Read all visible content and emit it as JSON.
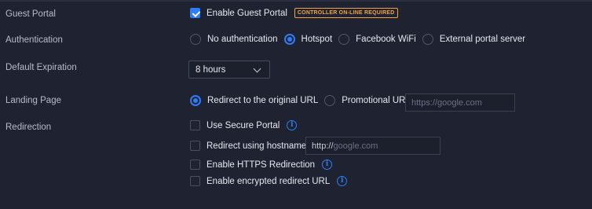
{
  "guest_portal": {
    "label": "Guest Portal",
    "enable_label": "Enable Guest Portal",
    "enabled": true,
    "badge": "CONTROLLER ON-LINE REQUIRED"
  },
  "authentication": {
    "label": "Authentication",
    "options": [
      "No authentication",
      "Hotspot",
      "Facebook WiFi",
      "External portal server"
    ],
    "selected": "Hotspot"
  },
  "default_expiration": {
    "label": "Default Expiration",
    "value": "8 hours"
  },
  "landing_page": {
    "label": "Landing Page",
    "options": [
      "Redirect to the original URL",
      "Promotional URL"
    ],
    "selected": "Redirect to the original URL",
    "url_placeholder": "https://google.com"
  },
  "redirection": {
    "label": "Redirection",
    "use_secure_portal": "Use Secure Portal",
    "redirect_hostname": "Redirect using hostname",
    "hostname_prefix": "http://",
    "hostname_placeholder": "google.com",
    "https_redirection": "Enable HTTPS Redirection",
    "encrypted_redirect": "Enable encrypted redirect URL"
  },
  "colors": {
    "background": "#1f2231",
    "accent": "#2f7df6",
    "warning": "#f0a33b"
  },
  "icons": [
    "check-icon",
    "info-icon",
    "chevron-down-icon"
  ]
}
